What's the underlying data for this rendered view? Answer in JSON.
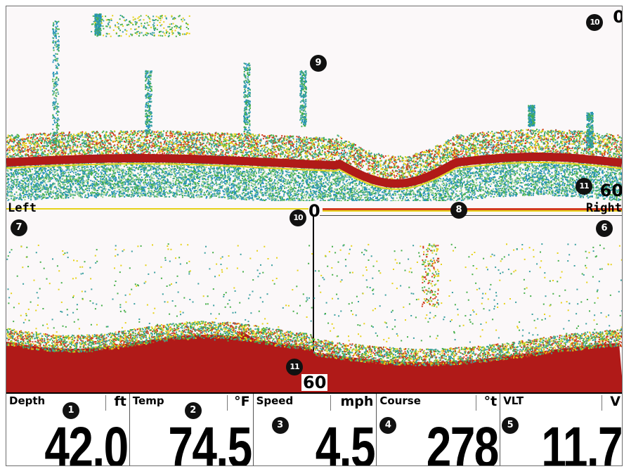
{
  "down_view": {
    "scale_top": "0",
    "scale_bottom": "60",
    "callouts": {
      "top_scale": "10",
      "water_column": "9",
      "bottom_scale": "11"
    }
  },
  "side_view": {
    "left_label": "Left",
    "right_label": "Right",
    "scale_top": "0",
    "scale_bottom": "60",
    "callouts": {
      "left": "7",
      "right": "6",
      "history": "8",
      "top_scale": "10",
      "bottom_scale": "11"
    }
  },
  "digital_readouts": [
    {
      "label": "Depth",
      "unit": "ft",
      "value": "42.0",
      "callout": "1"
    },
    {
      "label": "Temp",
      "unit": "°F",
      "value": "74.5",
      "callout": "2"
    },
    {
      "label": "Speed",
      "unit": "mph",
      "value": "4.5",
      "callout": "3"
    },
    {
      "label": "Course",
      "unit": "°t",
      "value": "278",
      "callout": "4"
    },
    {
      "label": "VLT",
      "unit": "V",
      "value": "11.7",
      "callout": "5"
    }
  ],
  "colors": {
    "background": "#fbf8f9",
    "bottom_return": "#b01a18",
    "strong_return": "#d23b1e",
    "medium_return": "#e6d21a",
    "weak_return": "#3aa0a0",
    "faint_return": "#1e8fbf",
    "green_return": "#46b04a"
  }
}
